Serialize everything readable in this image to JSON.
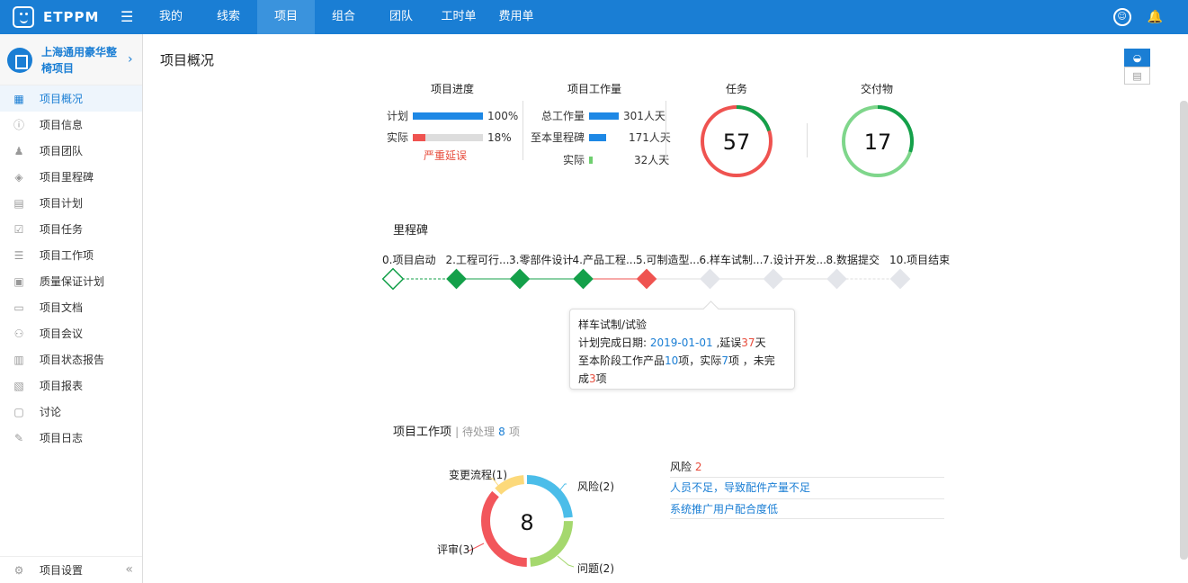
{
  "topbar": {
    "brand": "ETPPM",
    "nav": [
      "我的",
      "线索",
      "项目",
      "组合",
      "团队",
      "工时单",
      "费用单"
    ],
    "active_nav": "项目"
  },
  "sidebar": {
    "project_name": "上海通用豪华整椅项目",
    "items": [
      {
        "label": "项目概况",
        "icon": "grid-icon"
      },
      {
        "label": "项目信息",
        "icon": "info-icon"
      },
      {
        "label": "项目团队",
        "icon": "team-icon"
      },
      {
        "label": "项目里程碑",
        "icon": "milestone-icon"
      },
      {
        "label": "项目计划",
        "icon": "calendar-icon"
      },
      {
        "label": "项目任务",
        "icon": "task-icon"
      },
      {
        "label": "项目工作项",
        "icon": "list-icon"
      },
      {
        "label": "质量保证计划",
        "icon": "quality-icon"
      },
      {
        "label": "项目文档",
        "icon": "document-icon"
      },
      {
        "label": "项目会议",
        "icon": "meeting-icon"
      },
      {
        "label": "项目状态报告",
        "icon": "report-icon"
      },
      {
        "label": "项目报表",
        "icon": "chart-icon"
      },
      {
        "label": "讨论",
        "icon": "chat-icon"
      },
      {
        "label": "项目日志",
        "icon": "log-icon"
      }
    ],
    "footer": "项目设置"
  },
  "page": {
    "title": "项目概况"
  },
  "progress": {
    "title": "项目进度",
    "plan_label": "计划",
    "plan_value": "100%",
    "plan_fraction": 1.0,
    "actual_label": "实际",
    "actual_value": "18%",
    "actual_fraction": 0.18,
    "warning": "严重延误"
  },
  "workload": {
    "title": "项目工作量",
    "rows": [
      {
        "label": "总工作量",
        "value": "301人天",
        "fraction": 1.0,
        "color": "#1e88e5"
      },
      {
        "label": "至本里程碑",
        "value": "171人天",
        "fraction": 0.57,
        "color": "#1e88e5"
      },
      {
        "label": "实际",
        "value": "32人天",
        "fraction": 0.11,
        "color": "#6fcf6f"
      }
    ]
  },
  "tasks": {
    "title": "任务",
    "count": "57",
    "completed_fraction": 0.2
  },
  "deliverables": {
    "title": "交付物",
    "count": "17",
    "completed_fraction": 0.3
  },
  "milestones": {
    "title": "里程碑",
    "items": [
      {
        "label": "0.项目启动",
        "status": "start"
      },
      {
        "label": "2.工程可行...",
        "status": "done"
      },
      {
        "label": "3.零部件设计",
        "status": "done"
      },
      {
        "label": "4.产品工程...",
        "status": "done"
      },
      {
        "label": "5.可制造型...",
        "status": "late"
      },
      {
        "label": "6.样车试制...",
        "status": "future"
      },
      {
        "label": "7.设计开发...",
        "status": "future"
      },
      {
        "label": "8.数据提交",
        "status": "future"
      },
      {
        "label": "10.项目结束",
        "status": "future"
      }
    ],
    "tooltip": {
      "title": "样车试制/试验",
      "plan_label": "计划完成日期:",
      "plan_date": "2019-01-01",
      "delay_prefix": ",延误",
      "delay_days": "37",
      "delay_suffix": "天",
      "line2_prefix": "至本阶段工作产品",
      "total": "10",
      "line2_mid": "项，实际",
      "actual": "7",
      "line2_suffix": "项 ，未完",
      "line3_prefix": "成",
      "remaining": "3",
      "line3_suffix": "项"
    }
  },
  "work_items": {
    "title": "项目工作项",
    "pending_label": "待处理",
    "pending_count": "8",
    "pending_unit": "项",
    "total": "8",
    "segments": [
      {
        "label": "风险(2)",
        "value": 2,
        "color": "#4bbde9"
      },
      {
        "label": "问题(2)",
        "value": 2,
        "color": "#a5d86e"
      },
      {
        "label": "评审(3)",
        "value": 3,
        "color": "#f2565b"
      },
      {
        "label": "变更流程(1)",
        "value": 1,
        "color": "#fcd97a"
      }
    ]
  },
  "risks": {
    "title": "风险",
    "count": "2",
    "items": [
      "人员不足，导致配件产量不足",
      "系统推广用户配合度低"
    ]
  }
}
